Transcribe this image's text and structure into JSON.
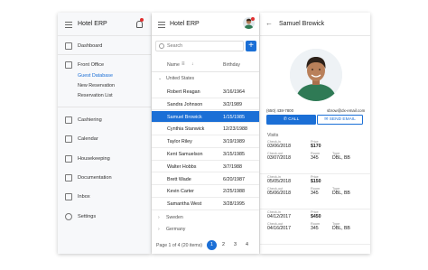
{
  "app": {
    "title": "Hotel ERP"
  },
  "nav": {
    "items": [
      {
        "label": "Dashboard"
      },
      {
        "label": "Front Office"
      },
      {
        "label": "Cashiering"
      },
      {
        "label": "Calendar"
      },
      {
        "label": "Housekeeping"
      },
      {
        "label": "Documentation"
      },
      {
        "label": "Inbox"
      },
      {
        "label": "Settings"
      }
    ],
    "subitems": [
      {
        "label": "Guest Database",
        "active": true
      },
      {
        "label": "New Reservation"
      },
      {
        "label": "Reservation List"
      }
    ]
  },
  "list": {
    "search_placeholder": "Search",
    "add_label": "+",
    "columns": {
      "name": "Name",
      "birthday": "Birthday"
    },
    "groups": [
      {
        "label": "United States",
        "expanded": true
      },
      {
        "label": "Sweden",
        "expanded": false
      },
      {
        "label": "Germany",
        "expanded": false
      }
    ],
    "rows": [
      {
        "name": "Robert Reagan",
        "birthday": "3/16/1964"
      },
      {
        "name": "Sandra Johnson",
        "birthday": "3/2/1989"
      },
      {
        "name": "Samuel Browick",
        "birthday": "1/15/1985",
        "selected": true
      },
      {
        "name": "Cynthia Stanwick",
        "birthday": "12/23/1988"
      },
      {
        "name": "Taylor Riley",
        "birthday": "3/19/1989"
      },
      {
        "name": "Kent Samuelson",
        "birthday": "3/15/1985"
      },
      {
        "name": "Walter Hobbs",
        "birthday": "3/7/1988"
      },
      {
        "name": "Brett Wade",
        "birthday": "6/20/1987"
      },
      {
        "name": "Kevin Carter",
        "birthday": "2/25/1988"
      },
      {
        "name": "Samantha West",
        "birthday": "3/28/1995"
      }
    ],
    "pager": {
      "info": "Page 1 of 4 (20 items)",
      "pages": [
        "1",
        "2",
        "3",
        "4"
      ],
      "current": "1"
    }
  },
  "detail": {
    "name": "Samuel Browick",
    "phone": "(650) 438-7800",
    "email": "sbrow@dx-email.com",
    "call_label": "CALL",
    "email_label": "SEND EMAIL",
    "visits_title": "Visits",
    "labels": {
      "checkin": "Check-in",
      "checkout": "Check-out",
      "price": "Price",
      "room": "Room",
      "type": "Type"
    },
    "visits": [
      {
        "checkin": "03/06/2018",
        "checkout": "03/07/2018",
        "price": "$170",
        "room": "345",
        "type": "DBL, BB"
      },
      {
        "checkin": "05/05/2018",
        "checkout": "05/06/2018",
        "price": "$150",
        "room": "345",
        "type": "DBL, BB"
      },
      {
        "checkin": "04/12/2017",
        "checkout": "04/16/2017",
        "price": "$450",
        "room": "345",
        "type": "DBL, BB"
      }
    ]
  },
  "colors": {
    "accent": "#1b6fd6",
    "notification": "#e02f2f",
    "nav_bg": "#f7f8fa"
  },
  "icons": {
    "nav": [
      "dashboard-icon",
      "front-office-icon",
      "cashiering-icon",
      "calendar-icon",
      "housekeeping-icon",
      "documentation-icon",
      "inbox-icon",
      "settings-icon"
    ]
  }
}
